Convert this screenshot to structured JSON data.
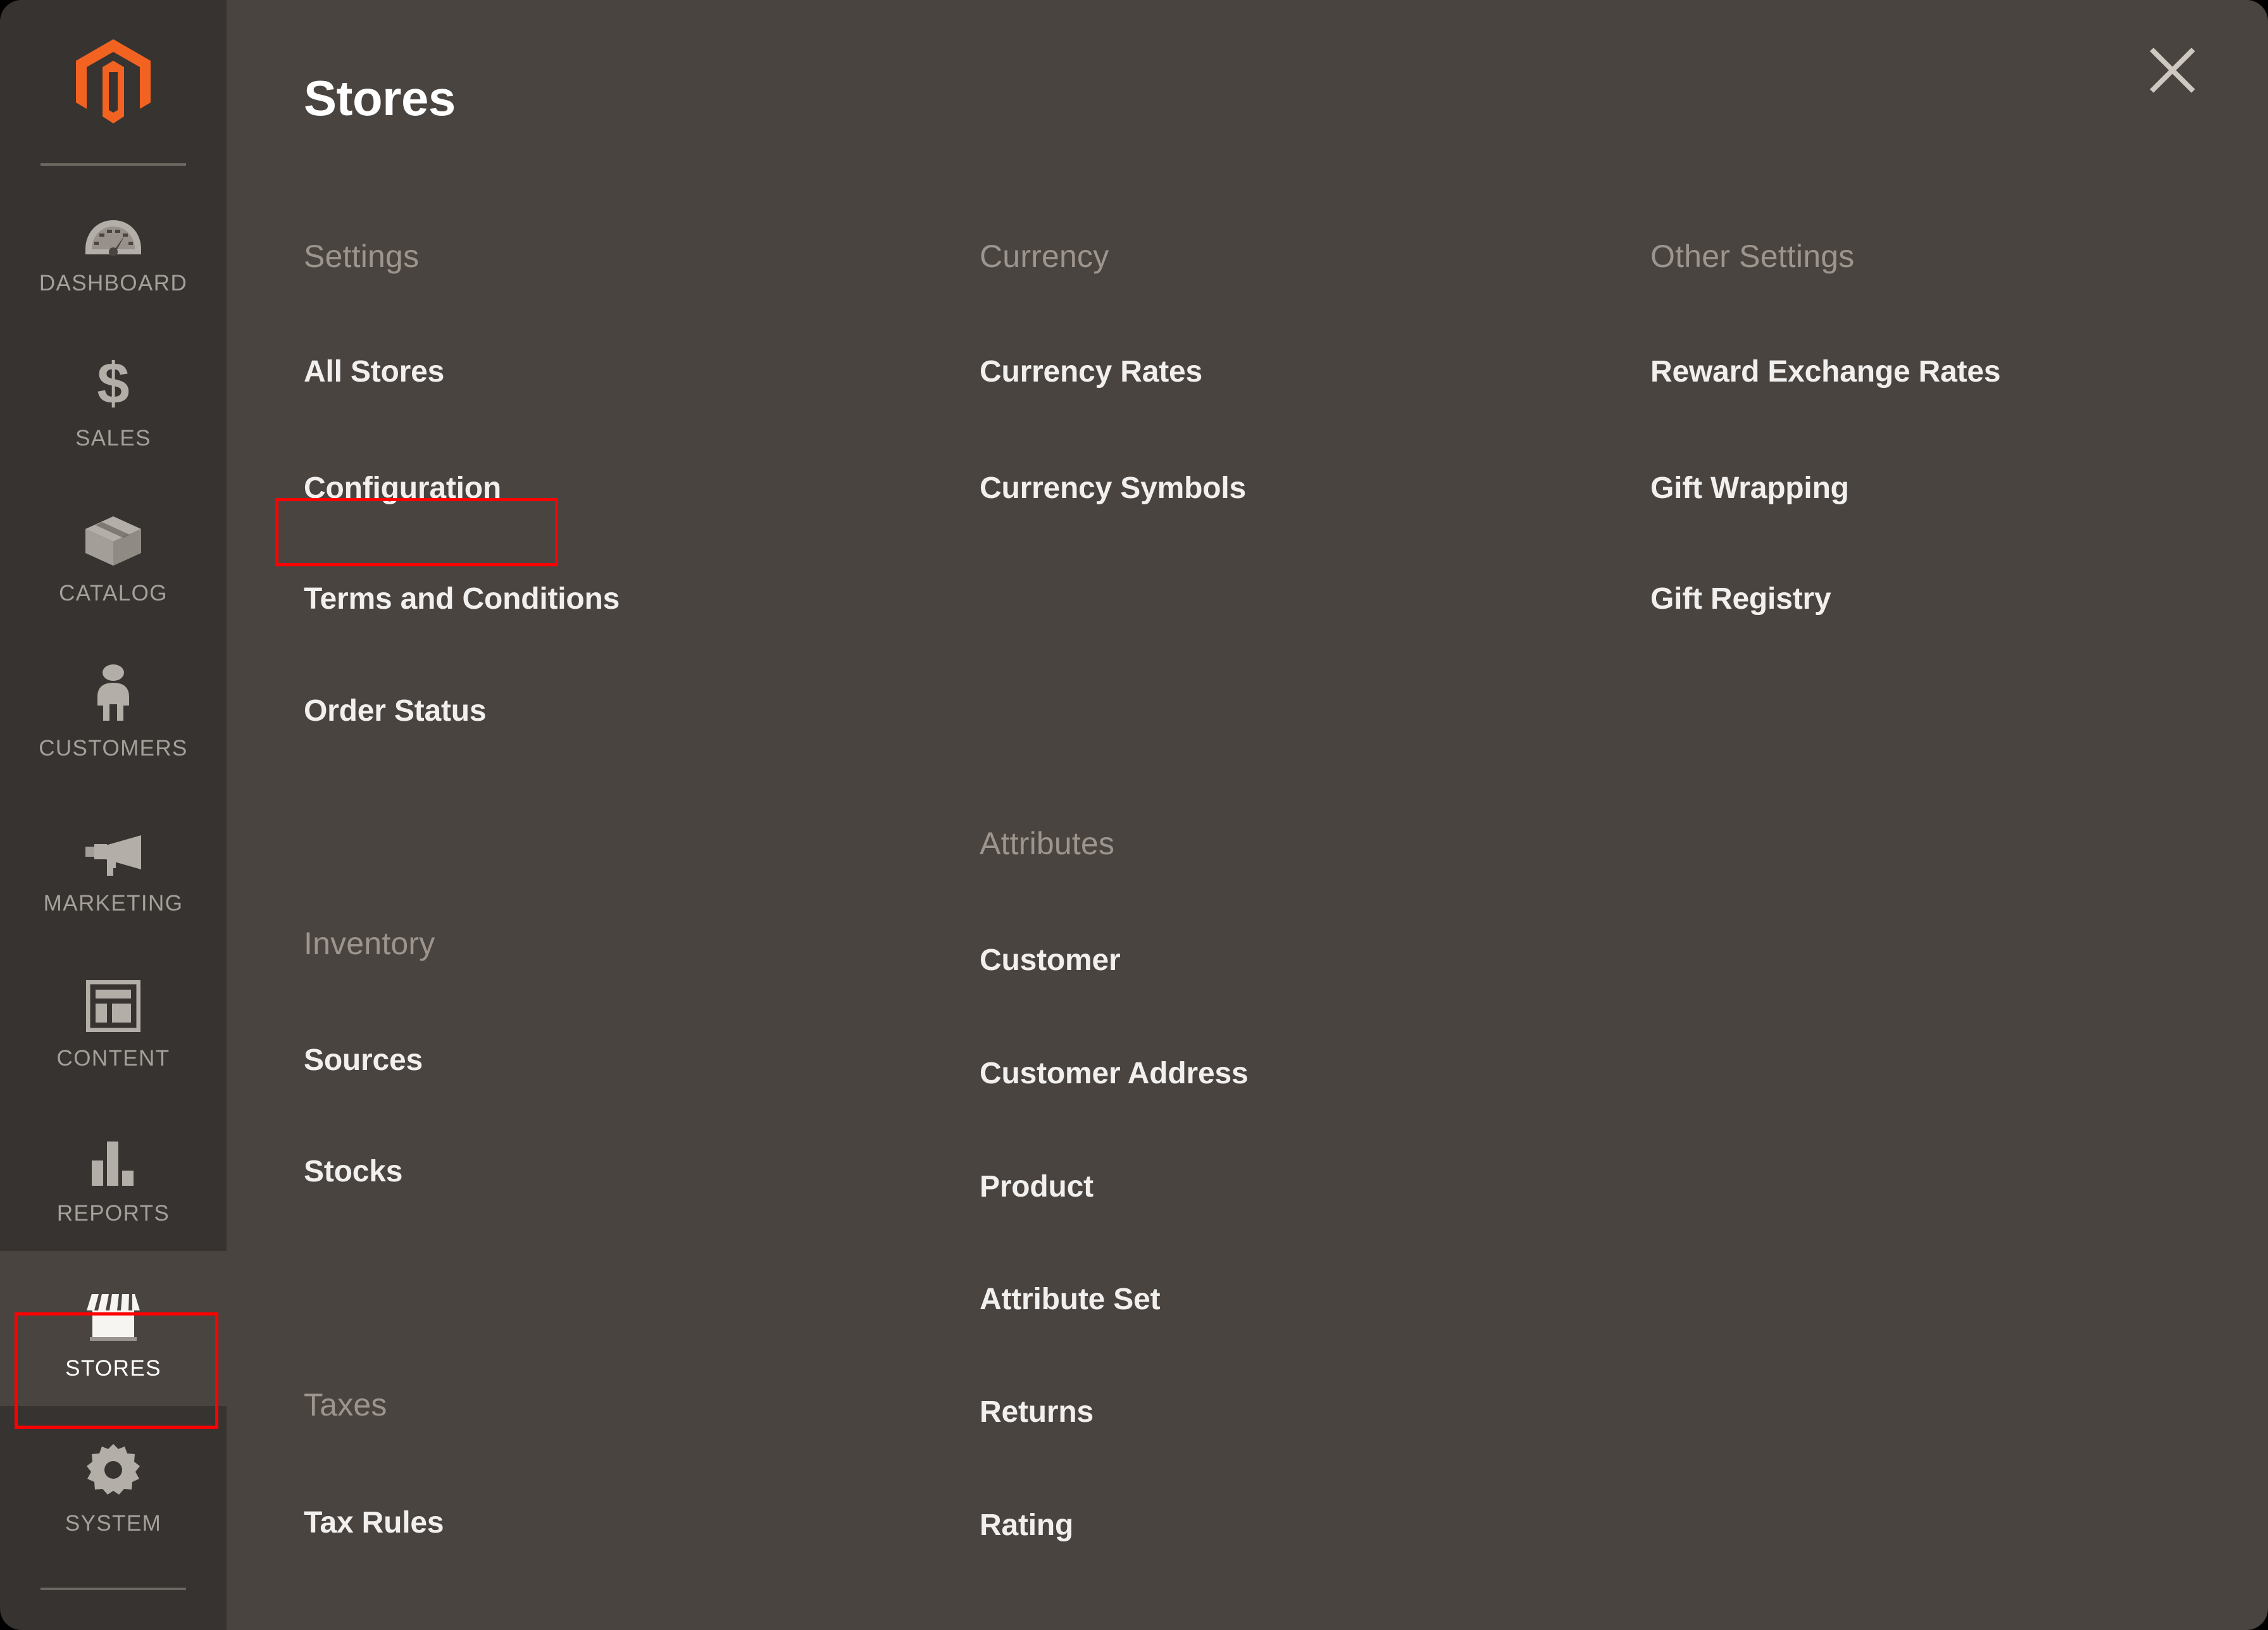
{
  "sidebar": {
    "logo_name": "magento-logo",
    "items": [
      {
        "label": "DASHBOARD",
        "icon": "gauge-icon",
        "active": false
      },
      {
        "label": "SALES",
        "icon": "dollar-icon",
        "active": false
      },
      {
        "label": "CATALOG",
        "icon": "box-icon",
        "active": false
      },
      {
        "label": "CUSTOMERS",
        "icon": "person-icon",
        "active": false
      },
      {
        "label": "MARKETING",
        "icon": "megaphone-icon",
        "active": false
      },
      {
        "label": "CONTENT",
        "icon": "layout-icon",
        "active": false
      },
      {
        "label": "REPORTS",
        "icon": "bar-chart-icon",
        "active": false
      },
      {
        "label": "STORES",
        "icon": "storefront-icon",
        "active": true
      },
      {
        "label": "SYSTEM",
        "icon": "gear-icon",
        "active": false
      }
    ]
  },
  "panel": {
    "title": "Stores",
    "close_icon": "close-icon",
    "columns": [
      {
        "groups": [
          {
            "title": "Settings",
            "items": [
              "All Stores",
              "Configuration",
              "Terms and Conditions",
              "Order Status"
            ]
          },
          {
            "title": "Inventory",
            "items": [
              "Sources",
              "Stocks"
            ]
          },
          {
            "title": "Taxes",
            "items": [
              "Tax Rules"
            ]
          }
        ]
      },
      {
        "groups": [
          {
            "title": "Currency",
            "items": [
              "Currency Rates",
              "Currency Symbols"
            ]
          },
          {
            "title": "Attributes",
            "items": [
              "Customer",
              "Customer Address",
              "Product",
              "Attribute Set",
              "Returns",
              "Rating"
            ]
          }
        ]
      },
      {
        "groups": [
          {
            "title": "Other Settings",
            "items": [
              "Reward Exchange Rates",
              "Gift Wrapping",
              "Gift Registry"
            ]
          }
        ]
      }
    ]
  },
  "annotations": {
    "color": "#fe0000",
    "targets": [
      "Configuration",
      "STORES"
    ]
  },
  "colors": {
    "sidebar_bg": "#373330",
    "panel_bg": "#4a4440",
    "group_title": "#9d958d",
    "link": "#f2f0ee",
    "logo_orange": "#f26322",
    "annotation_red": "#fe0000"
  }
}
